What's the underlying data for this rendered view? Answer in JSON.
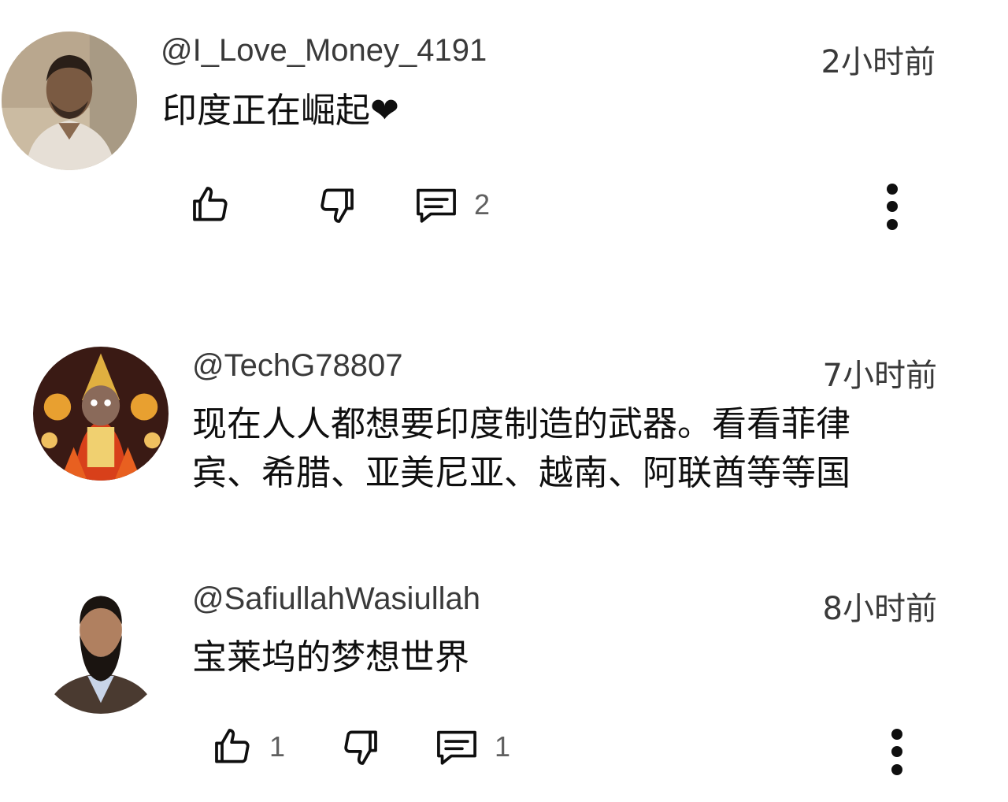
{
  "comments": [
    {
      "author": "@I_Love_Money_4191",
      "time": "2小时前",
      "text": "印度正在崛起❤",
      "reply_count": "2",
      "like_count": ""
    },
    {
      "author": "@TechG78807",
      "time": "7小时前",
      "text_line1": "现在人人都想要印度制造的武器。看看菲律",
      "text_line2": "宾、希腊、亚美尼亚、越南、阿联酋等等国"
    },
    {
      "author": "@SafiullahWasiullah",
      "time": "8小时前",
      "text": "宝莱坞的梦想世界",
      "like_count": "1",
      "reply_count": "1"
    }
  ],
  "icons": {
    "like": "thumb-up-icon",
    "dislike": "thumb-down-icon",
    "reply": "comment-icon",
    "more": "more-vert-icon"
  },
  "colors": {
    "text": "#0f0f0f",
    "meta": "#3a3a3a",
    "icon": "#0f0f0f",
    "count": "#606060"
  }
}
